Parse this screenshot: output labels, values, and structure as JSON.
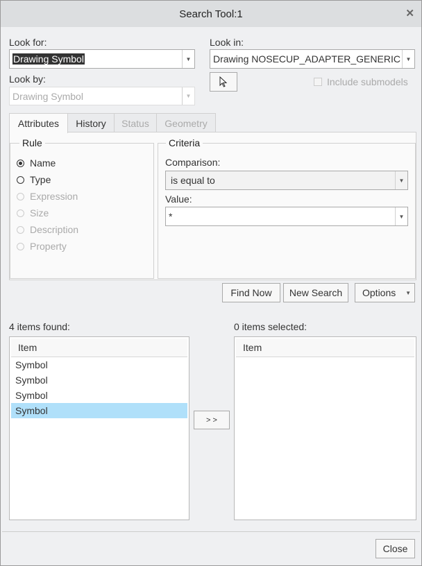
{
  "window": {
    "title": "Search Tool:1",
    "close_icon": "close-icon"
  },
  "look_for": {
    "label": "Look for:",
    "value": "Drawing Symbol"
  },
  "look_in": {
    "label": "Look in:",
    "value": "Drawing NOSECUP_ADAPTER_GENERIC"
  },
  "look_by": {
    "label": "Look by:",
    "value": "Drawing Symbol"
  },
  "include_submodels": {
    "label": "Include submodels",
    "checked": false
  },
  "tabs": [
    {
      "label": "Attributes"
    },
    {
      "label": "History"
    },
    {
      "label": "Status"
    },
    {
      "label": "Geometry"
    }
  ],
  "rule": {
    "title": "Rule",
    "options": [
      {
        "label": "Name"
      },
      {
        "label": "Type"
      },
      {
        "label": "Expression"
      },
      {
        "label": "Size"
      },
      {
        "label": "Description"
      },
      {
        "label": "Property"
      }
    ]
  },
  "criteria": {
    "title": "Criteria",
    "comparison_label": "Comparison:",
    "comparison_value": "is equal to",
    "value_label": "Value:",
    "value": "*"
  },
  "buttons": {
    "find_now": "Find Now",
    "new_search": "New Search",
    "options": "Options",
    "add": "> >",
    "close": "Close"
  },
  "found": {
    "label": "4 items found:",
    "header": "Item",
    "items": [
      "Symbol",
      "Symbol",
      "Symbol",
      "Symbol"
    ]
  },
  "selected": {
    "label": "0 items selected:",
    "header": "Item"
  }
}
